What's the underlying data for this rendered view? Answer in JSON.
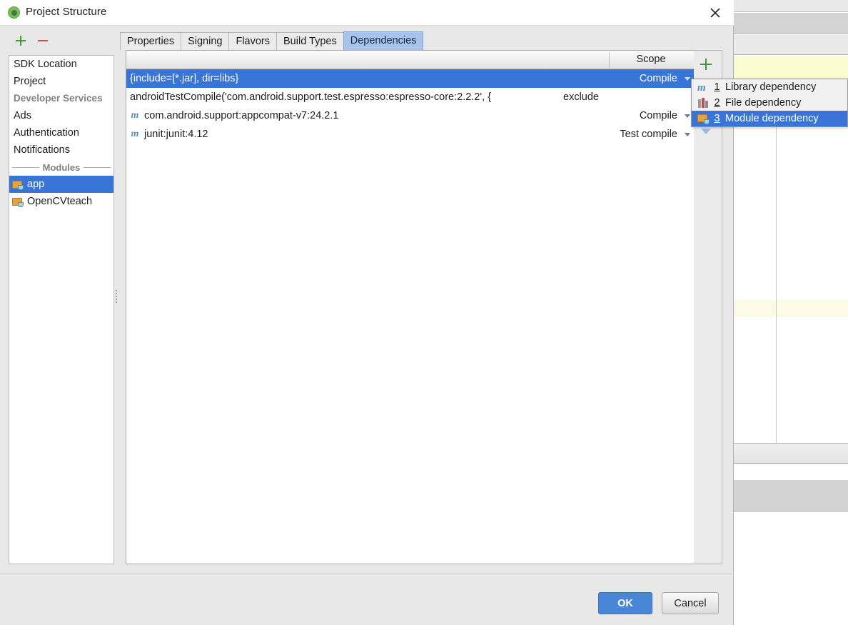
{
  "window": {
    "title": "Project Structure",
    "icon": "android-studio-icon",
    "close_label": "✕"
  },
  "toolbar": {
    "add_label": "+",
    "remove_label": "−"
  },
  "sidebar": {
    "items": [
      {
        "label": "SDK Location",
        "type": "item",
        "selected": false
      },
      {
        "label": "Project",
        "type": "item",
        "selected": false
      },
      {
        "label": "Developer Services",
        "type": "group",
        "selected": false
      },
      {
        "label": "Ads",
        "type": "item",
        "selected": false
      },
      {
        "label": "Authentication",
        "type": "item",
        "selected": false
      },
      {
        "label": "Notifications",
        "type": "item",
        "selected": false
      }
    ],
    "modules_separator": "Modules",
    "modules": [
      {
        "label": "app",
        "icon": "module-folder-icon",
        "selected": true
      },
      {
        "label": "OpenCVteach",
        "icon": "module-folder-icon",
        "selected": false
      }
    ]
  },
  "tabs": [
    {
      "label": "Properties",
      "active": false
    },
    {
      "label": "Signing",
      "active": false
    },
    {
      "label": "Flavors",
      "active": false
    },
    {
      "label": "Build Types",
      "active": false
    },
    {
      "label": "Dependencies",
      "active": true
    }
  ],
  "table": {
    "columns": [
      {
        "label": "",
        "key": "name"
      },
      {
        "label": "Scope",
        "key": "scope"
      }
    ],
    "rows": [
      {
        "icon": "",
        "name": "{include=[*.jar], dir=libs}",
        "mid": "",
        "scope": "Compile",
        "selected": true,
        "has_caret": true
      },
      {
        "icon": "",
        "name": "androidTestCompile('com.android.support.test.espresso:espresso-core:2.2.2', {",
        "mid": "exclude",
        "scope": "",
        "selected": false,
        "has_caret": false
      },
      {
        "icon": "m",
        "name": "com.android.support:appcompat-v7:24.2.1",
        "mid": "",
        "scope": "Compile",
        "selected": false,
        "has_caret": true
      },
      {
        "icon": "m",
        "name": "junit:junit:4.12",
        "mid": "",
        "scope": "Test compile",
        "selected": false,
        "has_caret": true
      }
    ]
  },
  "table_buttons": {
    "add_label": "+",
    "down_label": "▼"
  },
  "popup_menu": {
    "items": [
      {
        "num": "1",
        "label": "Library dependency",
        "icon": "maven-m-icon",
        "highlight": false
      },
      {
        "num": "2",
        "label": "File dependency",
        "icon": "books-icon",
        "highlight": false
      },
      {
        "num": "3",
        "label": "Module dependency",
        "icon": "module-folder-icon",
        "highlight": true
      }
    ]
  },
  "footer": {
    "ok_label": "OK",
    "cancel_label": "Cancel"
  },
  "colors": {
    "selection_blue": "#3875d7",
    "tab_active": "#a7c3e9",
    "ok_button": "#4a86d8",
    "plus_green": "#3f9a3f",
    "minus_red": "#c0554d",
    "editor_highlight": "#fbfbd2"
  }
}
